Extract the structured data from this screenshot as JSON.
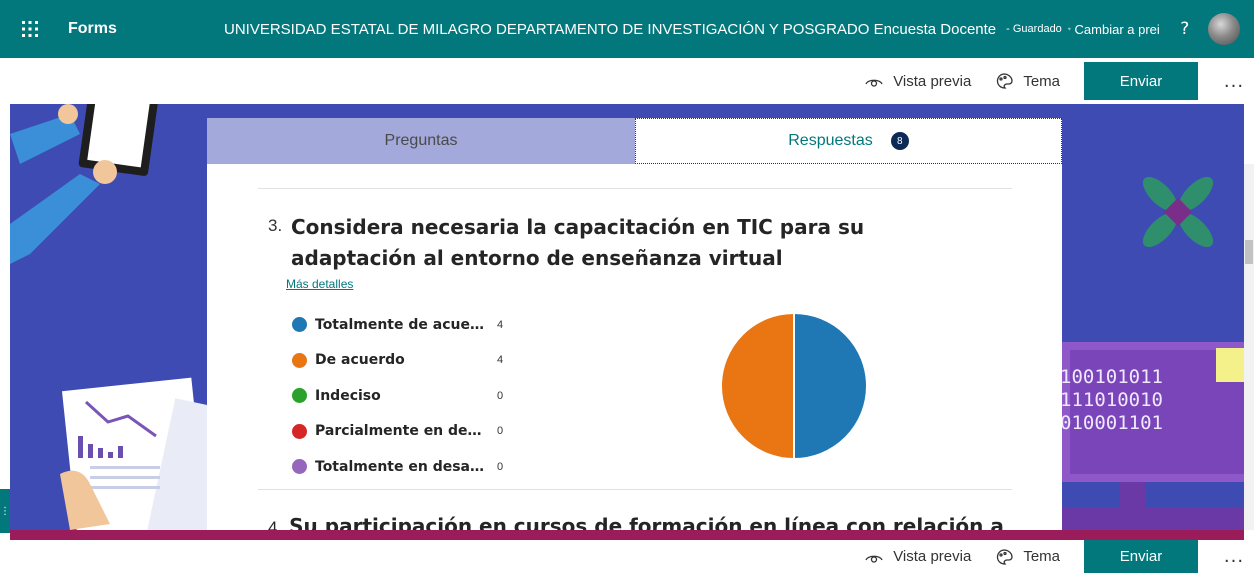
{
  "topbar": {
    "app_name": "Forms",
    "form_title": "UNIVERSIDAD ESTATAL DE MILAGRO DEPARTAMENTO DE INVESTIGACIÓN Y POSGRADO Encuesta Docente",
    "saved_status": "- Guardado",
    "switch_label": "Cambiar a prei",
    "help_label": "?"
  },
  "commands": {
    "preview": "Vista previa",
    "theme": "Tema",
    "send": "Enviar",
    "more": "..."
  },
  "tabs": {
    "questions": "Preguntas",
    "responses": "Respuestas",
    "responses_count": "8"
  },
  "question3": {
    "number": "3.",
    "title": "Considera necesaria la capacitación en TIC para su adaptación al entorno de enseñanza virtual",
    "more_details": "Más detalles",
    "options": [
      {
        "label": "Totalmente de acuerdo",
        "count": "4",
        "color": "#1f77b4"
      },
      {
        "label": "De acuerdo",
        "count": "4",
        "color": "#e97513"
      },
      {
        "label": "Indeciso",
        "count": "0",
        "color": "#2ca02c"
      },
      {
        "label": "Parcialmente en desac...",
        "count": "0",
        "color": "#d62728"
      },
      {
        "label": "Totalmente en desacu...",
        "count": "0",
        "color": "#9467bd"
      }
    ]
  },
  "question4": {
    "number": "4.",
    "title_partial": "Su participación en cursos de formación en línea con relación a las"
  },
  "colors": {
    "brand": "#03787c",
    "theme_bg": "#3d4bb3",
    "tab_inactive": "#a3a9da",
    "footer_accent": "#9a1c5a"
  }
}
